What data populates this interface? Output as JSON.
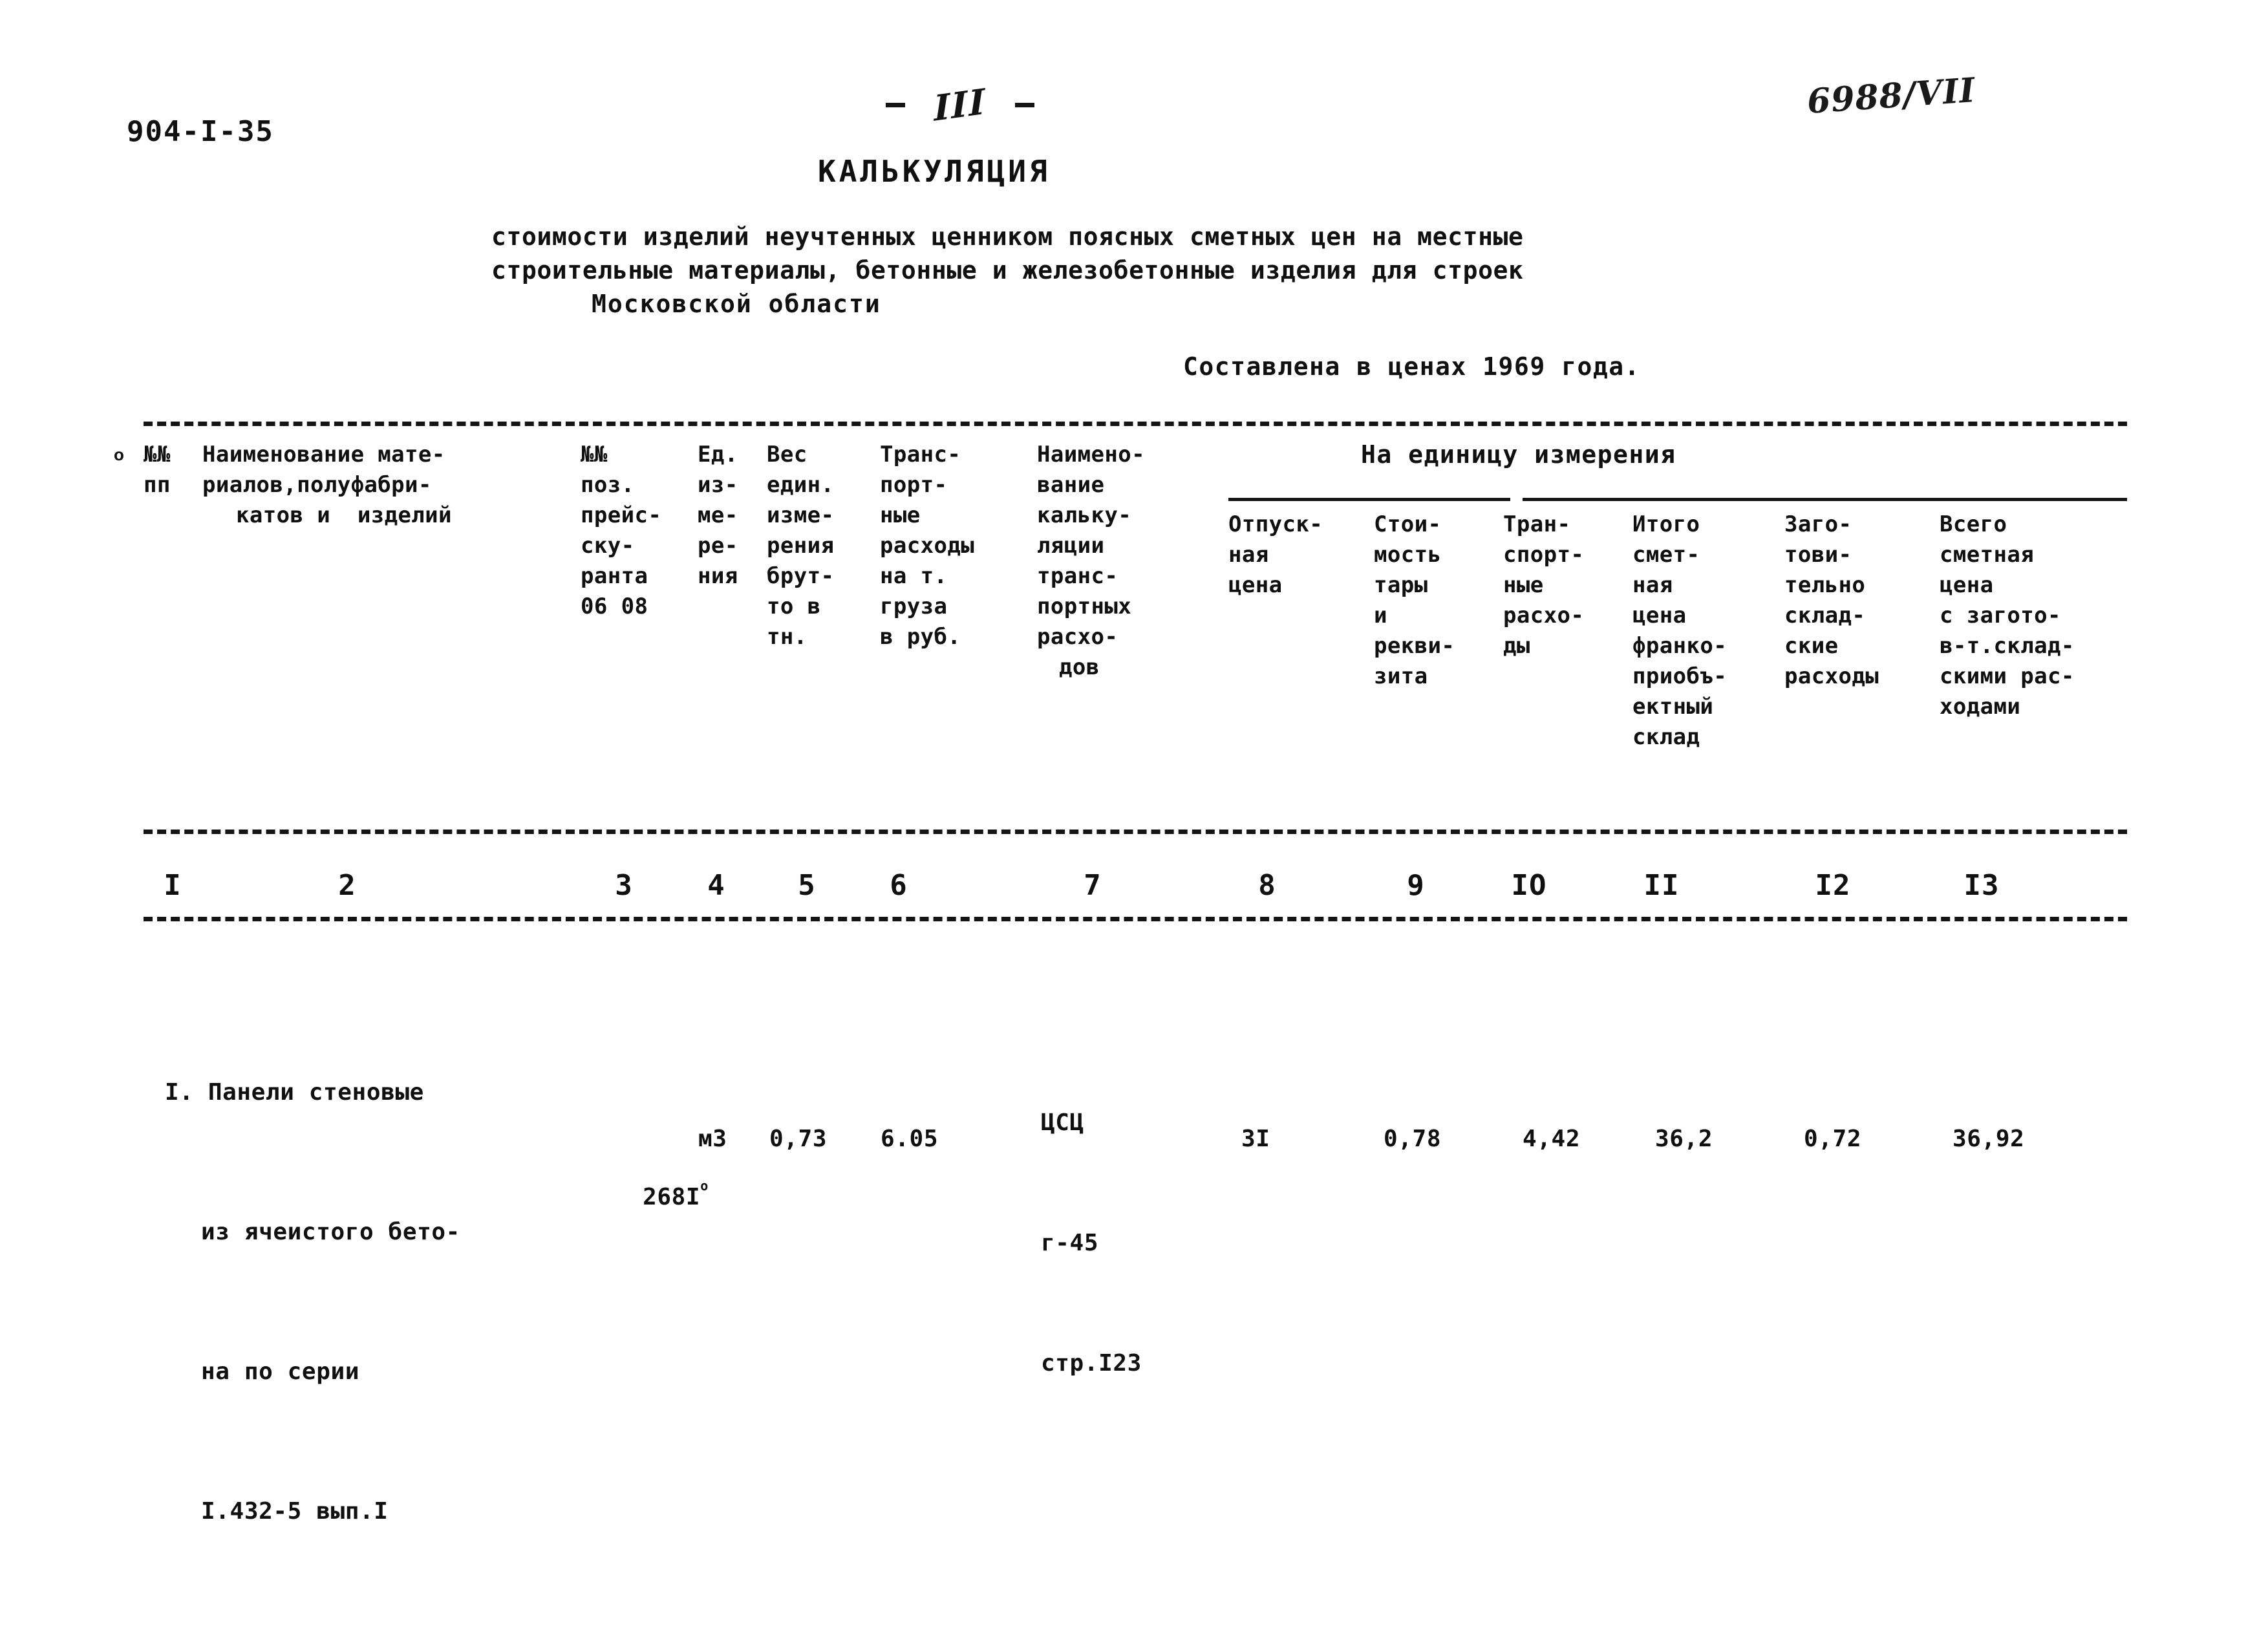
{
  "document": {
    "code": "904-I-35",
    "page_number": "III",
    "archive_mark": "6988/VII",
    "title": "КАЛЬКУЛЯЦИЯ",
    "subtitle_line_1": "стоимости изделий неучтенных ценником поясных сметных цен на местные",
    "subtitle_line_2": "строительные материалы, бетонные и железобетонные изделия для строек",
    "subtitle_line_3": "Московской области",
    "compiled_note": "Составлена в ценах 1969 года.",
    "header_artifact": "о"
  },
  "table": {
    "group_header": "На единицу измерения",
    "headers": [
      {
        "id": "col1",
        "lines": [
          "№№",
          "пп"
        ]
      },
      {
        "id": "col2",
        "lines": [
          "Наименование мате-",
          "риалов,полуфабри-",
          "катов и  изделий"
        ]
      },
      {
        "id": "col3",
        "lines": [
          "№№",
          "поз.",
          "прейс-",
          "ску-",
          "ранта",
          "06 08"
        ]
      },
      {
        "id": "col4",
        "lines": [
          "Ед.",
          "из-",
          "ме-",
          "ре-",
          "ния"
        ]
      },
      {
        "id": "col5",
        "lines": [
          "Вес",
          "един.",
          "изме-",
          "рения",
          "брут-",
          "то в",
          "тн."
        ]
      },
      {
        "id": "col6",
        "lines": [
          "Транс-",
          "порт-",
          "ные",
          "расходы",
          "на т.",
          "груза",
          "в руб."
        ]
      },
      {
        "id": "col7",
        "lines": [
          "Наимено-",
          "вание",
          "кальку-",
          "ляции",
          "транс-",
          "портных",
          "расхо-",
          "дов"
        ]
      },
      {
        "id": "col8",
        "lines": [
          "Отпуск-",
          "ная",
          "цена"
        ]
      },
      {
        "id": "col9",
        "lines": [
          "Стои-",
          "мость",
          "тары",
          "и",
          "рекви-",
          "зита"
        ]
      },
      {
        "id": "col10",
        "lines": [
          "Тран-",
          "спорт-",
          "ные",
          "расхо-",
          "ды"
        ]
      },
      {
        "id": "col11",
        "lines": [
          "Итого",
          "смет-",
          "ная",
          "цена",
          "франко-",
          "приобъ-",
          "ектный",
          "склад"
        ]
      },
      {
        "id": "col12",
        "lines": [
          "Загo-",
          "тови-",
          "тельно",
          "склад-",
          "ские",
          "расходы"
        ]
      },
      {
        "id": "col13",
        "lines": [
          "Всего",
          "сметная",
          "цена",
          "с загото-",
          "в-т.склад-",
          "скими рас-",
          "ходами"
        ]
      }
    ],
    "column_numbers": [
      "I",
      "2",
      "3",
      "4",
      "5",
      "6",
      "7",
      "8",
      "9",
      "IO",
      "II",
      "I2",
      "I3"
    ],
    "rows": [
      {
        "name_lines": [
          "I. Панели стеновые",
          "из ячеистого бето-",
          "на по серии",
          "I.432-5 вып.I"
        ],
        "price_list_pos": "268I",
        "price_list_pos_sup": "о",
        "unit": "м3",
        "weight_brutto_tn": "0,73",
        "transport_per_tn_rub": "6.05",
        "calc_name_lines": [
          "ЦСЦ",
          "г-45",
          "стр.I23"
        ],
        "release_price": "3I",
        "packaging_cost": "0,78",
        "transport_cost": "4,42",
        "total_franco_site": "36,2",
        "procurement_cost": "0,72",
        "grand_total": "36,92"
      }
    ]
  }
}
